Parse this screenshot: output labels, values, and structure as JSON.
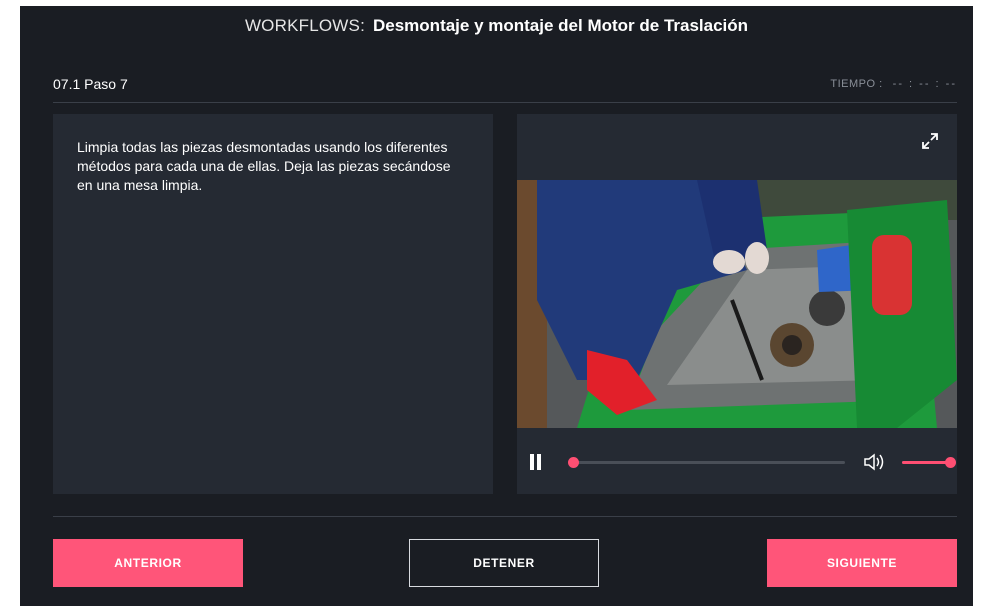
{
  "header": {
    "prefix": "WORKFLOWS:",
    "title": "Desmontaje y montaje del Motor de Traslación"
  },
  "step": {
    "label": "07.1 Paso 7",
    "time_label": "TIEMPO :",
    "time_value": "-- : -- : --"
  },
  "instruction": {
    "text": "Limpia todas las piezas desmontadas usando los diferentes métodos para cada una de ellas. Deja las piezas secándose en una mesa limpia."
  },
  "video": {
    "state": "playing",
    "progress_fraction": 0.0,
    "volume_fraction": 1.0,
    "icons": [
      "expand-icon",
      "pause-icon",
      "volume-icon"
    ]
  },
  "buttons": {
    "previous": "ANTERIOR",
    "stop": "DETENER",
    "next": "SIGUIENTE"
  },
  "colors": {
    "accent": "#ff5579",
    "background": "#1a1d23",
    "panel": "#252a33"
  }
}
